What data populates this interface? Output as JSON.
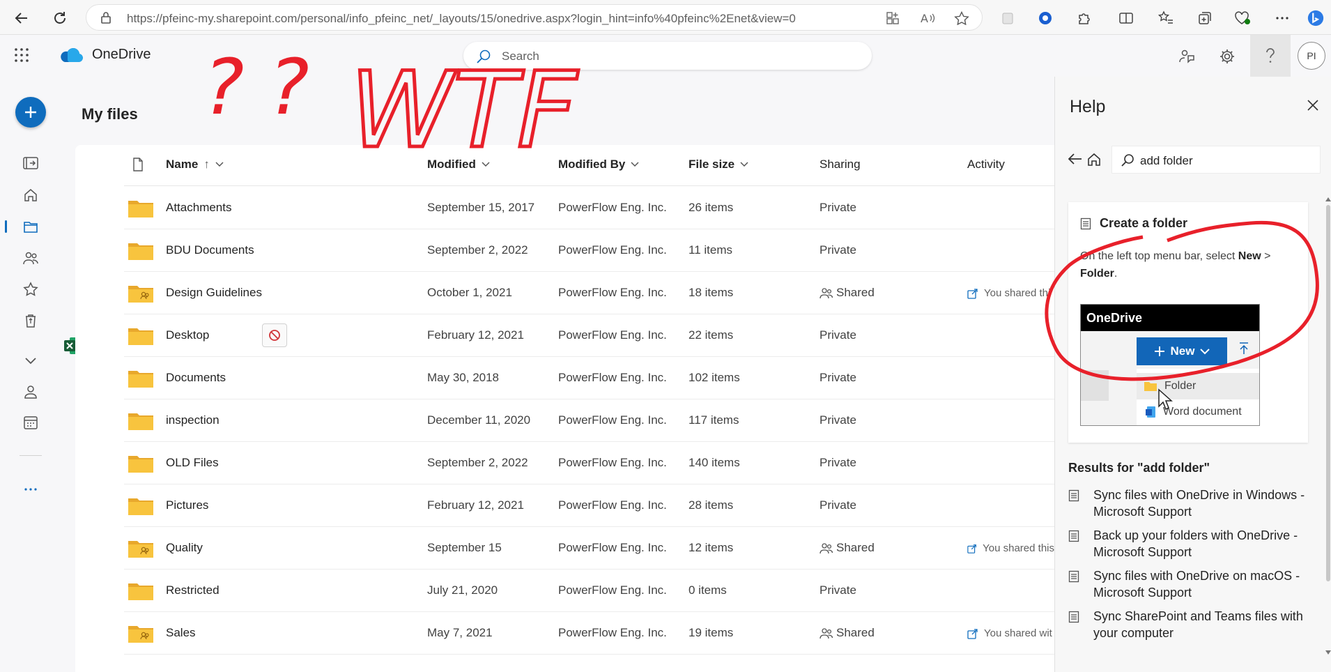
{
  "browser": {
    "url": "https://pfeinc-my.sharepoint.com/personal/info_pfeinc_net/_layouts/15/onedrive.aspx?login_hint=info%40pfeinc%2Enet&view=0",
    "ai_label": "A⁰"
  },
  "header": {
    "brand": "OneDrive",
    "search_placeholder": "Search",
    "avatar_initials": "PI"
  },
  "page": {
    "title": "My files"
  },
  "columns": {
    "name": "Name",
    "sort_arrow": "↑",
    "modified": "Modified",
    "modified_by": "Modified By",
    "file_size": "File size",
    "sharing": "Sharing",
    "activity": "Activity"
  },
  "files": [
    {
      "name": "Attachments",
      "modified": "September 15, 2017",
      "by": "PowerFlow Eng. Inc.",
      "size": "26 items",
      "sharing": "Private",
      "shared": false,
      "activity": ""
    },
    {
      "name": "BDU Documents",
      "modified": "September 2, 2022",
      "by": "PowerFlow Eng. Inc.",
      "size": "11 items",
      "sharing": "Private",
      "shared": false,
      "activity": ""
    },
    {
      "name": "Design Guidelines",
      "modified": "October 1, 2021",
      "by": "PowerFlow Eng. Inc.",
      "size": "18 items",
      "sharing": "Shared",
      "shared": true,
      "activity": "You shared thi"
    },
    {
      "name": "Desktop",
      "modified": "February 12, 2021",
      "by": "PowerFlow Eng. Inc.",
      "size": "22 items",
      "sharing": "Private",
      "shared": false,
      "activity": "",
      "blocked": true
    },
    {
      "name": "Documents",
      "modified": "May 30, 2018",
      "by": "PowerFlow Eng. Inc.",
      "size": "102 items",
      "sharing": "Private",
      "shared": false,
      "activity": ""
    },
    {
      "name": "inspection",
      "modified": "December 11, 2020",
      "by": "PowerFlow Eng. Inc.",
      "size": "117 items",
      "sharing": "Private",
      "shared": false,
      "activity": ""
    },
    {
      "name": "OLD Files",
      "modified": "September 2, 2022",
      "by": "PowerFlow Eng. Inc.",
      "size": "140 items",
      "sharing": "Private",
      "shared": false,
      "activity": ""
    },
    {
      "name": "Pictures",
      "modified": "February 12, 2021",
      "by": "PowerFlow Eng. Inc.",
      "size": "28 items",
      "sharing": "Private",
      "shared": false,
      "activity": ""
    },
    {
      "name": "Quality",
      "modified": "September 15",
      "by": "PowerFlow Eng. Inc.",
      "size": "12 items",
      "sharing": "Shared",
      "shared": true,
      "activity": "You shared this"
    },
    {
      "name": "Restricted",
      "modified": "July 21, 2020",
      "by": "PowerFlow Eng. Inc.",
      "size": "0 items",
      "sharing": "Private",
      "shared": false,
      "activity": ""
    },
    {
      "name": "Sales",
      "modified": "May 7, 2021",
      "by": "PowerFlow Eng. Inc.",
      "size": "19 items",
      "sharing": "Shared",
      "shared": true,
      "activity": "You shared wit"
    }
  ],
  "help": {
    "title": "Help",
    "search_value": "add folder",
    "card_title": "Create a folder",
    "card_text_before": "On the left top menu bar, select ",
    "card_text_bold1": "New",
    "card_text_mid": " > ",
    "card_text_bold2": "Folder",
    "card_text_end": ".",
    "shot_brand": "OneDrive",
    "shot_new": "New",
    "shot_folder": "Folder",
    "shot_word": "Word document",
    "results_heading": "Results for \"add folder\"",
    "results": [
      "Sync files with OneDrive in Windows - Microsoft Support",
      "Back up your folders with OneDrive - Microsoft Support",
      "Sync files with OneDrive on macOS - Microsoft Support",
      "Sync SharePoint and Teams files with your computer"
    ]
  },
  "annotations": {
    "question_marks": "? ?",
    "text": "WTF",
    "color": "#e8202a"
  },
  "colors": {
    "accent": "#0f6cbd",
    "folder": "#f8c43e",
    "folder_front": "#ffd45e"
  }
}
